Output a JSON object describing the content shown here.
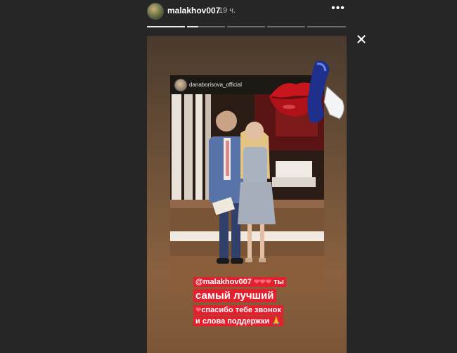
{
  "header": {
    "username": "malakhov007",
    "time_ago": "19 ч.",
    "more_icon": "•••",
    "close_icon": "✕"
  },
  "progress": {
    "segments": 5,
    "current_segment": 2,
    "current_fill": 0.3
  },
  "story": {
    "reposted_post": {
      "username": "danaborisova_official"
    },
    "caption": {
      "mention": "@malakhov007",
      "hearts": "❤❤❤",
      "line1_suffix": "ты",
      "line2": "самый лучший",
      "line3": "спасибо тебе звонок",
      "line4": "и слова поддержки",
      "prayer_icon": "🙏"
    },
    "stickers": [
      "lips-sticker",
      "phone-sticker"
    ]
  },
  "colors": {
    "background": "#262626",
    "caption_bg": "#e3202e",
    "lips": "#c8161f"
  }
}
